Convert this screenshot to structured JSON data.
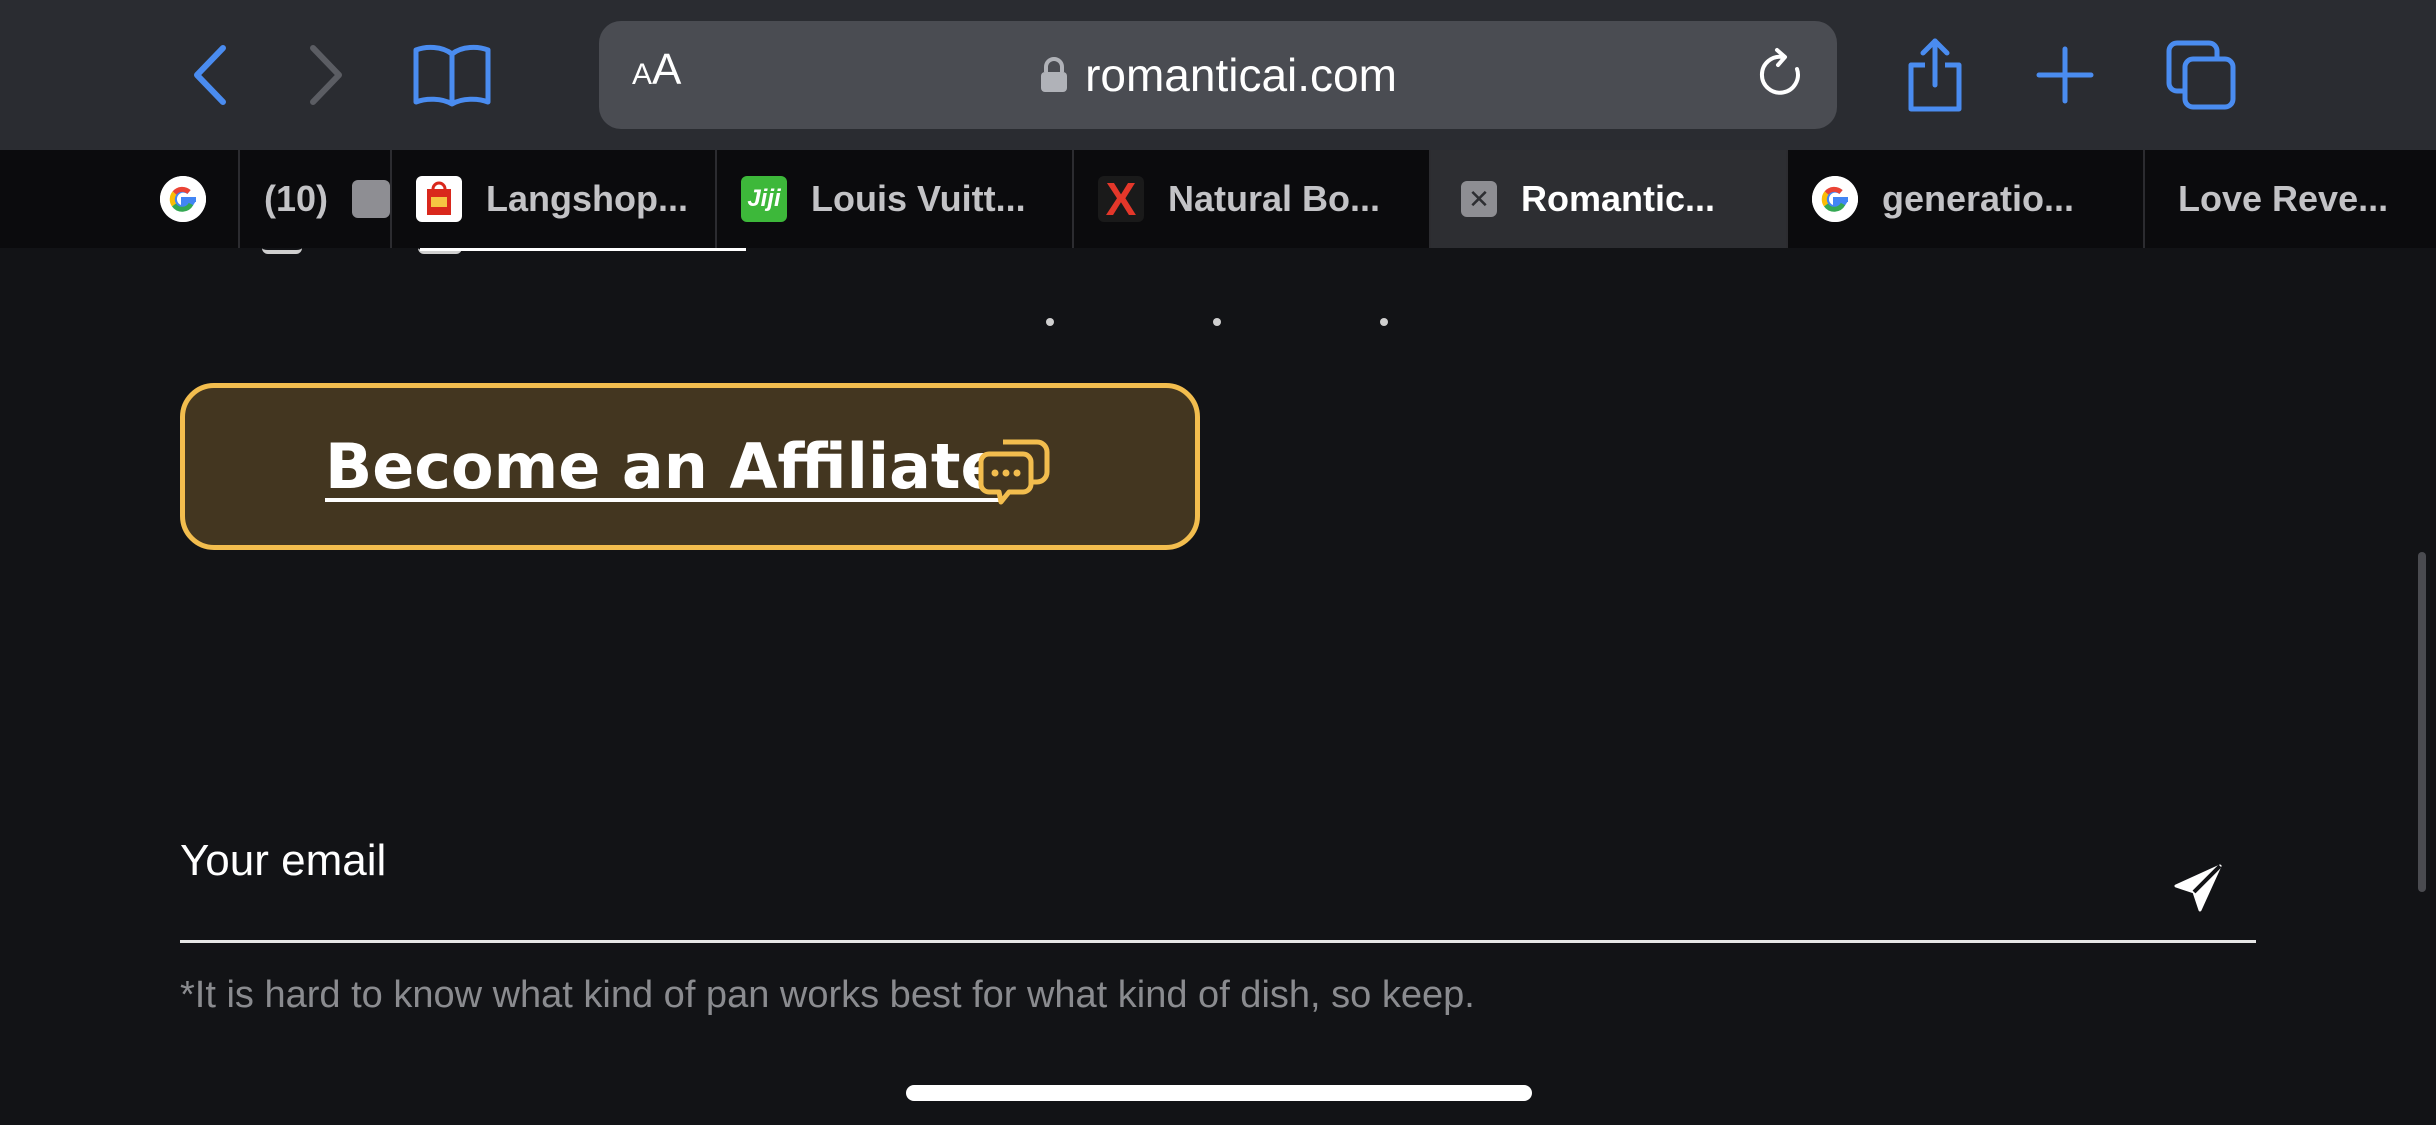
{
  "browser": {
    "url_display": "romanticai.com",
    "reader_small": "A",
    "reader_big": "A",
    "accent_color": "#4a8cf0"
  },
  "tabs": [
    {
      "label": "",
      "icon": "google-icon"
    },
    {
      "label": "(10)",
      "icon": "grey-square-icon"
    },
    {
      "label": "Langshop...",
      "icon": "langshop-icon"
    },
    {
      "label": "Louis Vuitt...",
      "icon": "jiji-icon",
      "icon_text": "Jiji"
    },
    {
      "label": "Natural Bo...",
      "icon": "x-logo-icon",
      "icon_text": "X"
    },
    {
      "label": "Romantic...",
      "icon": "close-tab-icon",
      "icon_text": "✕",
      "active": true
    },
    {
      "label": "generatio...",
      "icon": "google-icon"
    },
    {
      "label": "Love Reve...",
      "icon": ""
    }
  ],
  "page": {
    "affiliate_button": "Become an Affiliate",
    "email_label": "Your email",
    "note": "*It is hard to know what kind of pan works best for what kind of dish, so keep.",
    "button_color": "#433620",
    "button_border": "#f2bd4e"
  }
}
